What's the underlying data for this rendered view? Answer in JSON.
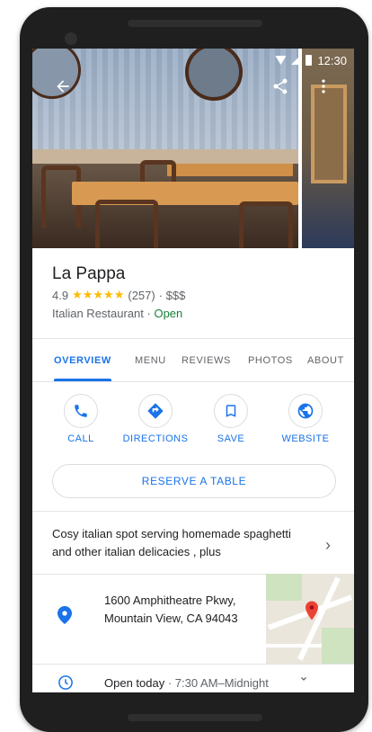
{
  "status_bar": {
    "time": "12:30"
  },
  "place": {
    "name": "La Pappa",
    "rating": "4.9",
    "stars": "★★★★★",
    "reviews_count": "(257)",
    "price": "· $$$",
    "category": "Italian Restaurant ·",
    "open_status": "Open"
  },
  "tabs": [
    {
      "label": "OVERVIEW"
    },
    {
      "label": "MENU"
    },
    {
      "label": "REVIEWS"
    },
    {
      "label": "PHOTOS"
    },
    {
      "label": "ABOUT"
    }
  ],
  "actions": [
    {
      "label": "CALL",
      "icon": "phone-icon"
    },
    {
      "label": "DIRECTIONS",
      "icon": "directions-icon"
    },
    {
      "label": "SAVE",
      "icon": "bookmark-icon"
    },
    {
      "label": "WEBSITE",
      "icon": "globe-icon"
    }
  ],
  "reserve": {
    "label": "RESERVE A TABLE"
  },
  "description": "Cosy italian spot  serving homemade spaghetti and other italian delicacies , plus",
  "address": "1600 Amphitheatre Pkwy, Mountain View, CA 94043",
  "hours": {
    "status": "Open today",
    "range": "· 7:30 AM–Midnight"
  },
  "colors": {
    "accent": "#1a73e8",
    "open": "#188038",
    "star": "#fbbc04",
    "pin": "#ea4335"
  }
}
